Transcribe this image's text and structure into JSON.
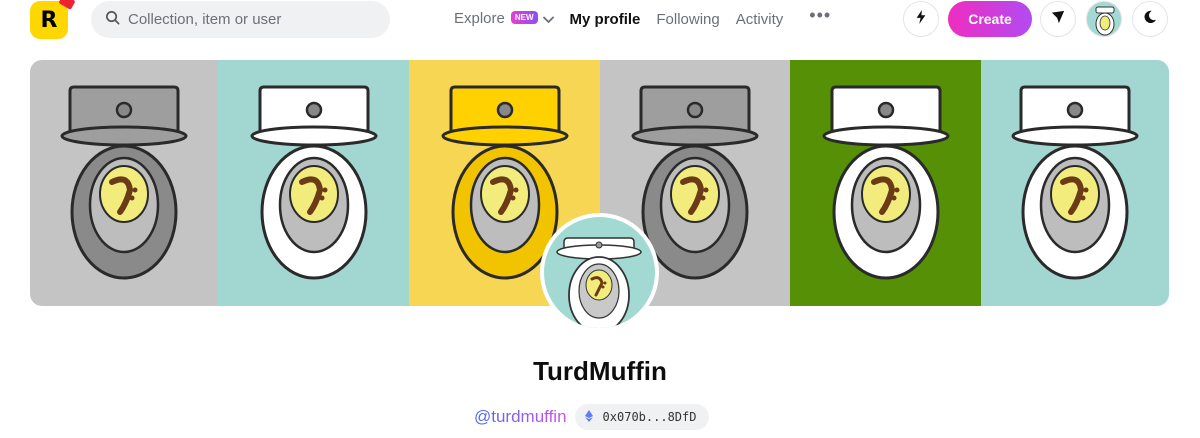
{
  "header": {
    "logo_letter": "R",
    "search": {
      "placeholder": "Collection, item or user"
    },
    "nav": [
      {
        "label": "Explore",
        "badge": "NEW"
      },
      {
        "label": "My profile"
      },
      {
        "label": "Following"
      },
      {
        "label": "Activity"
      }
    ],
    "more_label": "•••",
    "create_label": "Create",
    "icons": [
      "search-icon",
      "chevron-down-icon",
      "lightning-icon",
      "send-icon",
      "moon-icon"
    ]
  },
  "banner": {
    "tiles": [
      {
        "bg": "#c4c4c4",
        "tank": "#9e9e9e",
        "bowl": "#8a8a8a",
        "water": "#f1ec7c"
      },
      {
        "bg": "#a2d6d1",
        "tank": "#ffffff",
        "bowl": "#ffffff",
        "water": "#f1ec7c"
      },
      {
        "bg": "#f7d654",
        "tank": "#ffd100",
        "bowl": "#f2c400",
        "water": "#f1ec7c"
      },
      {
        "bg": "#c4c4c4",
        "tank": "#9e9e9e",
        "bowl": "#8a8a8a",
        "water": "#f1ec7c"
      },
      {
        "bg": "#559006",
        "tank": "#ffffff",
        "bowl": "#ffffff",
        "water": "#f1ec7c"
      },
      {
        "bg": "#a2d6d1",
        "tank": "#ffffff",
        "bowl": "#ffffff",
        "water": "#f1ec7c"
      }
    ]
  },
  "profile": {
    "name": "TurdMuffin",
    "handle": "@turdmuffin",
    "wallet": "0x070b...8DfD"
  },
  "colors": {
    "accent_start": "#ef2dbf",
    "accent_end": "#b24bf2",
    "logo": "#ffd700"
  }
}
